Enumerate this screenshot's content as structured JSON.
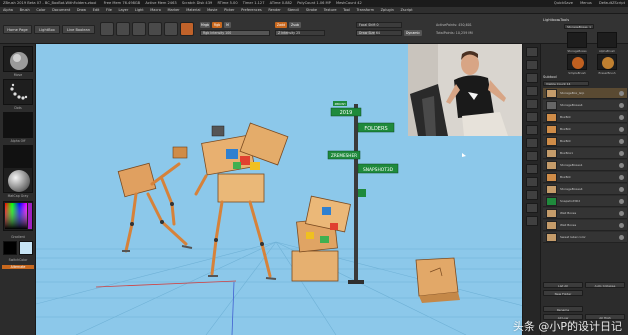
{
  "titlebar": {
    "title": "ZBrush 2019 Beta 07 - BC_BoxBot-WithFolders.ztool",
    "stats": [
      "Free Mem 76.498GB",
      "Active Mem 2463",
      "Scratch Disk 439",
      "RTime 5.00",
      "Timer 1.127",
      "ATime 0.882",
      "PolyCount 1.06 MP",
      "MeshCount 42"
    ],
    "right_items": [
      "QuickSave",
      "Menus",
      "DefaultZScript"
    ]
  },
  "menubar": {
    "items": [
      "Alpha",
      "Brush",
      "Color",
      "Document",
      "Draw",
      "Edit",
      "File",
      "Layer",
      "Light",
      "Macro",
      "Marker",
      "Material",
      "Movie",
      "Picker",
      "Preferences",
      "Render",
      "Stencil",
      "Stroke",
      "Texture",
      "Tool",
      "Transform",
      "Zplugin",
      "Zscript"
    ]
  },
  "toolbar": {
    "home_page": "Home Page",
    "lightbox": "LightBox",
    "live_boolean": "Live Boolean",
    "mrgb": "Mrgb",
    "rgb": "Rgb",
    "m": "M",
    "rgb_intensity": "Rgb Intensity 100",
    "zadd": "Zadd",
    "zsub": "Zsub",
    "z_intensity": "Z Intensity 25",
    "focal_shift": "Focal Shift 0",
    "draw_size": "Draw Size 64",
    "dynamic": "Dynamic",
    "active_points": "ActivePoints: 450,601",
    "total_points": "TotalPoints: 10,259 Mil"
  },
  "left_panel": {
    "labels": [
      "Move",
      "Dots",
      "Alpha Off",
      "Texture Off",
      "MatCap Gray",
      "Gradient",
      "SwitchColor",
      "Alternate"
    ]
  },
  "viewport": {
    "background": "#8cc8ea",
    "signs": [
      "2019",
      "FOLDERS",
      "ZREMESHER",
      "SNAPSHOT3D"
    ],
    "small_sign": "ZBRUSH"
  },
  "right_panel": {
    "title": "Lightbox▸Tools",
    "current_tool": "StorageBoxes_1",
    "tool_labels": [
      "StorageBoxes",
      "AlphaBrush",
      "SimpleBrush",
      "EraserBrush"
    ],
    "subtool_header": "Subtool",
    "visible_count": "Visible Count 14",
    "subtools": [
      "StorageBox_Grp",
      "StorageBoxes4",
      "BoxBot",
      "BoxBot",
      "BoxBot",
      "BoxBox1",
      "StorageBoxes1",
      "BoxBot",
      "StorageBoxes4",
      "Snapshot3D2",
      "Wall Boxes",
      "Wall Boxes",
      "Sweat label color"
    ],
    "bottom_buttons": [
      "List All",
      "Auto Collapse",
      "New Folder",
      "Rename",
      "All Low",
      "All High"
    ]
  },
  "webcam": {
    "description_colors": {
      "wall": "#d9d5cf",
      "shirt": "#1a1a1a",
      "skin": "#d8a585"
    }
  },
  "watermark": "头条 @小P的设计日记"
}
